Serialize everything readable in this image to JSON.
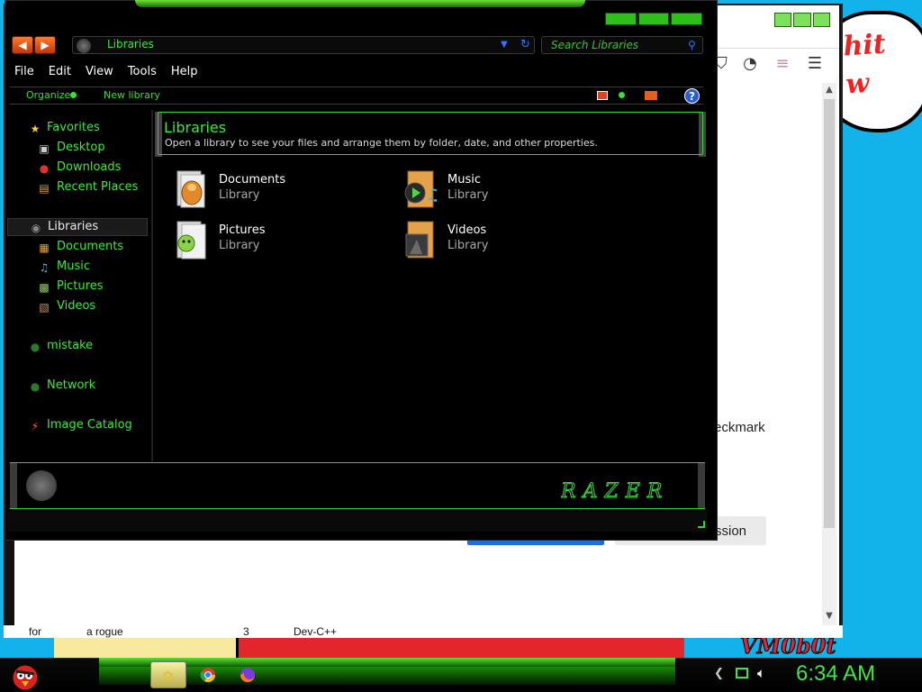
{
  "explorer": {
    "address": "Libraries",
    "search_placeholder": "Search Libraries",
    "menu": [
      "File",
      "Edit",
      "View",
      "Tools",
      "Help"
    ],
    "commands": {
      "organize": "Organize",
      "new_library": "New library"
    },
    "nav": {
      "favorites": "Favorites",
      "desktop": "Desktop",
      "downloads": "Downloads",
      "recent": "Recent Places",
      "libraries": "Libraries",
      "documents": "Documents",
      "music": "Music",
      "pictures": "Pictures",
      "videos": "Videos",
      "mistake": "mistake",
      "network": "Network",
      "image_catalog": "Image Catalog"
    },
    "content_title": "Libraries",
    "content_subtitle": "Open a library to see your files and arrange them by folder, date, and other properties.",
    "libraries": [
      {
        "name": "Documents",
        "type": "Library"
      },
      {
        "name": "Music",
        "type": "Library"
      },
      {
        "name": "Pictures",
        "type": "Library"
      },
      {
        "name": "Videos",
        "type": "Library"
      }
    ],
    "brand": "RAZER"
  },
  "browser": {
    "checkmark_fragment": "eckmark",
    "session_fragment": "ssion",
    "bottom_items": [
      "for",
      "a rogue",
      "3",
      "Dev-C++"
    ]
  },
  "desktop": {
    "bubble_text": "hit\nw",
    "vm_text": "VM0b0t"
  },
  "taskbar": {
    "clock": "6:34 AM"
  },
  "colors": {
    "accent_green": "#3ee83e",
    "window_bg": "#000000",
    "desktop_bg": "#12b2ea"
  }
}
